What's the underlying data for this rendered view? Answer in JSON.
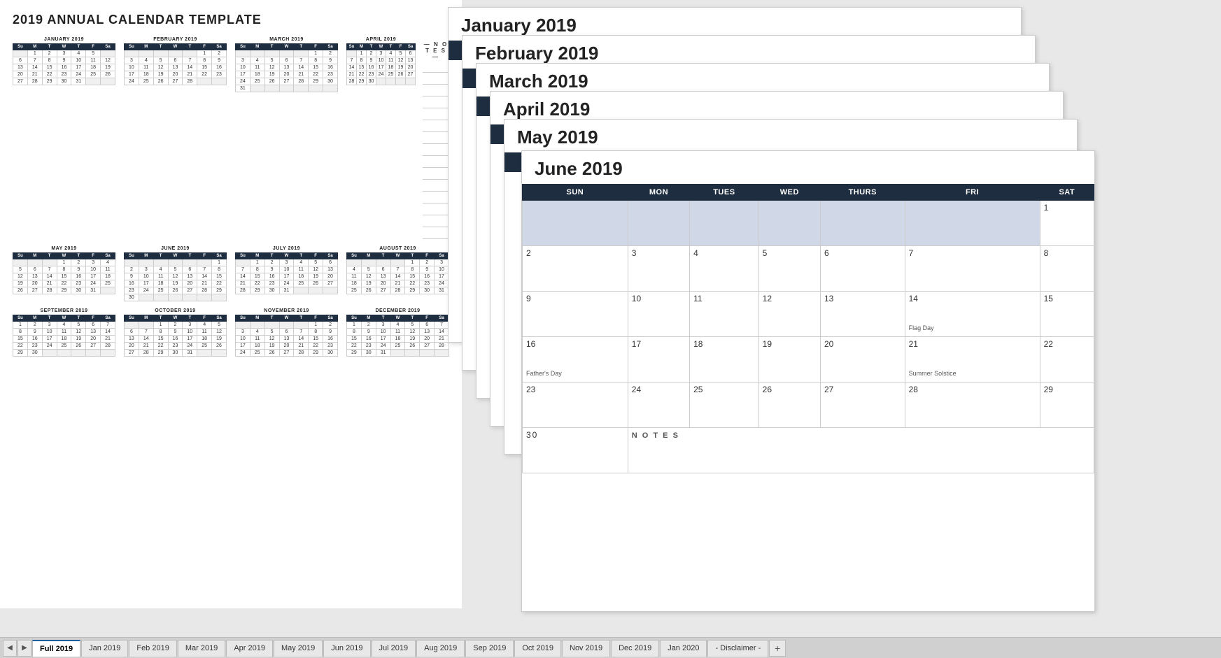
{
  "title": "2019 ANNUAL CALENDAR TEMPLATE",
  "months": {
    "jan": {
      "name": "JANUARY 2019",
      "headers": [
        "Su",
        "M",
        "T",
        "W",
        "T",
        "F",
        "Sa"
      ],
      "weeks": [
        [
          "",
          "1",
          "2",
          "3",
          "4",
          "5",
          ""
        ],
        [
          "6",
          "7",
          "8",
          "9",
          "10",
          "11",
          "12"
        ],
        [
          "13",
          "14",
          "15",
          "16",
          "17",
          "18",
          "19"
        ],
        [
          "20",
          "21",
          "22",
          "23",
          "24",
          "25",
          "26"
        ],
        [
          "27",
          "28",
          "29",
          "30",
          "31",
          "",
          ""
        ]
      ]
    },
    "feb": {
      "name": "FEBRUARY 2019",
      "headers": [
        "Su",
        "M",
        "T",
        "W",
        "T",
        "F",
        "Sa"
      ],
      "weeks": [
        [
          "",
          "",
          "",
          "",
          "",
          "1",
          "2"
        ],
        [
          "3",
          "4",
          "5",
          "6",
          "7",
          "8",
          "9"
        ],
        [
          "10",
          "11",
          "12",
          "13",
          "14",
          "15",
          "16"
        ],
        [
          "17",
          "18",
          "19",
          "20",
          "21",
          "22",
          "23"
        ],
        [
          "24",
          "25",
          "26",
          "27",
          "28",
          "",
          ""
        ]
      ]
    },
    "mar": {
      "name": "MARCH 2019",
      "headers": [
        "Su",
        "M",
        "T",
        "W",
        "T",
        "F",
        "Sa"
      ],
      "weeks": [
        [
          "",
          "",
          "",
          "",
          "",
          "1",
          "2"
        ],
        [
          "3",
          "4",
          "5",
          "6",
          "7",
          "8",
          "9"
        ],
        [
          "10",
          "11",
          "12",
          "13",
          "14",
          "15",
          "16"
        ],
        [
          "17",
          "18",
          "19",
          "20",
          "21",
          "22",
          "23"
        ],
        [
          "24",
          "25",
          "26",
          "27",
          "28",
          "29",
          "30"
        ],
        [
          "31",
          "",
          "",
          "",
          "",
          "",
          ""
        ]
      ]
    },
    "apr": {
      "name": "APRIL 2019",
      "headers": [
        "Su",
        "M",
        "T",
        "W",
        "T",
        "F",
        "Sa"
      ],
      "weeks": [
        [
          "",
          "1",
          "2",
          "3",
          "4",
          "5",
          "6"
        ],
        [
          "7",
          "8",
          "9",
          "10",
          "11",
          "12",
          "13"
        ],
        [
          "14",
          "15",
          "16",
          "17",
          "18",
          "19",
          "20"
        ],
        [
          "21",
          "22",
          "23",
          "24",
          "25",
          "26",
          "27"
        ],
        [
          "28",
          "29",
          "30",
          "",
          "",
          "",
          ""
        ]
      ]
    },
    "may": {
      "name": "MAY 2019",
      "headers": [
        "Su",
        "M",
        "T",
        "W",
        "T",
        "F",
        "Sa"
      ],
      "weeks": [
        [
          "",
          "",
          "",
          "1",
          "2",
          "3",
          "4"
        ],
        [
          "5",
          "6",
          "7",
          "8",
          "9",
          "10",
          "11"
        ],
        [
          "12",
          "13",
          "14",
          "15",
          "16",
          "17",
          "18"
        ],
        [
          "19",
          "20",
          "21",
          "22",
          "23",
          "24",
          "25"
        ],
        [
          "26",
          "27",
          "28",
          "29",
          "30",
          "31",
          ""
        ]
      ]
    },
    "jun": {
      "name": "JUNE 2019",
      "headers": [
        "Su",
        "M",
        "T",
        "W",
        "T",
        "F",
        "Sa"
      ],
      "weeks": [
        [
          "",
          "",
          "",
          "",
          "",
          "",
          "1"
        ],
        [
          "2",
          "3",
          "4",
          "5",
          "6",
          "7",
          "8"
        ],
        [
          "9",
          "10",
          "11",
          "12",
          "13",
          "14",
          "15"
        ],
        [
          "16",
          "17",
          "18",
          "19",
          "20",
          "21",
          "22"
        ],
        [
          "23",
          "24",
          "25",
          "26",
          "27",
          "28",
          "29"
        ],
        [
          "30",
          "",
          "",
          "",
          "",
          "",
          ""
        ]
      ],
      "notes": {
        "14": "Flag Day",
        "16": "Father's Day",
        "21": "Summer Solstice"
      }
    },
    "jul": {
      "name": "JULY 2019",
      "headers": [
        "Su",
        "M",
        "T",
        "W",
        "T",
        "F",
        "Sa"
      ],
      "weeks": [
        [
          "",
          "1",
          "2",
          "3",
          "4",
          "5",
          "6"
        ],
        [
          "7",
          "8",
          "9",
          "10",
          "11",
          "12",
          "13"
        ],
        [
          "14",
          "15",
          "16",
          "17",
          "18",
          "19",
          "20"
        ],
        [
          "21",
          "22",
          "23",
          "24",
          "25",
          "26",
          "27"
        ],
        [
          "28",
          "29",
          "30",
          "31",
          "",
          "",
          ""
        ]
      ]
    },
    "aug": {
      "name": "AUGUST 2019",
      "headers": [
        "Su",
        "M",
        "T",
        "W",
        "T",
        "F",
        "Sa"
      ],
      "weeks": [
        [
          "",
          "",
          "",
          "",
          "1",
          "2",
          "3"
        ],
        [
          "4",
          "5",
          "6",
          "7",
          "8",
          "9",
          "10"
        ],
        [
          "11",
          "12",
          "13",
          "14",
          "15",
          "16",
          "17"
        ],
        [
          "18",
          "19",
          "20",
          "21",
          "22",
          "23",
          "24"
        ],
        [
          "25",
          "26",
          "27",
          "28",
          "29",
          "30",
          "31"
        ]
      ]
    },
    "sep": {
      "name": "SEPTEMBER 2019",
      "headers": [
        "Su",
        "M",
        "T",
        "W",
        "T",
        "F",
        "Sa"
      ],
      "weeks": [
        [
          "1",
          "2",
          "3",
          "4",
          "5",
          "6",
          "7"
        ],
        [
          "8",
          "9",
          "10",
          "11",
          "12",
          "13",
          "14"
        ],
        [
          "15",
          "16",
          "17",
          "18",
          "19",
          "20",
          "21"
        ],
        [
          "22",
          "23",
          "24",
          "25",
          "26",
          "27",
          "28"
        ],
        [
          "29",
          "30",
          "",
          "",
          "",
          "",
          ""
        ]
      ]
    },
    "oct": {
      "name": "OCTOBER 2019",
      "headers": [
        "Su",
        "M",
        "T",
        "W",
        "T",
        "F",
        "Sa"
      ],
      "weeks": [
        [
          "",
          "",
          "1",
          "2",
          "3",
          "4",
          "5"
        ],
        [
          "6",
          "7",
          "8",
          "9",
          "10",
          "11",
          "12"
        ],
        [
          "13",
          "14",
          "15",
          "16",
          "17",
          "18",
          "19"
        ],
        [
          "20",
          "21",
          "22",
          "23",
          "24",
          "25",
          "26"
        ],
        [
          "27",
          "28",
          "29",
          "30",
          "31",
          "",
          ""
        ]
      ]
    },
    "nov": {
      "name": "NOVEMBER 2019",
      "headers": [
        "Su",
        "M",
        "T",
        "W",
        "T",
        "F",
        "Sa"
      ],
      "weeks": [
        [
          "",
          "",
          "",
          "",
          "",
          "1",
          "2"
        ],
        [
          "3",
          "4",
          "5",
          "6",
          "7",
          "8",
          "9"
        ],
        [
          "10",
          "11",
          "12",
          "13",
          "14",
          "15",
          "16"
        ],
        [
          "17",
          "18",
          "19",
          "20",
          "21",
          "22",
          "23"
        ],
        [
          "24",
          "25",
          "26",
          "27",
          "28",
          "29",
          "30"
        ]
      ]
    },
    "dec": {
      "name": "DECEMBER 2019",
      "headers": [
        "Su",
        "M",
        "T",
        "W",
        "T",
        "F",
        "Sa"
      ],
      "weeks": [
        [
          "1",
          "2",
          "3",
          "4",
          "5",
          "6",
          "7"
        ],
        [
          "8",
          "9",
          "10",
          "11",
          "12",
          "13",
          "14"
        ],
        [
          "15",
          "16",
          "17",
          "18",
          "19",
          "20",
          "21"
        ],
        [
          "22",
          "23",
          "24",
          "25",
          "26",
          "27",
          "28"
        ],
        [
          "29",
          "30",
          "31",
          "",
          "",
          "",
          ""
        ]
      ]
    }
  },
  "notes_label": "— N O T E S —",
  "tabs": [
    {
      "label": "Full 2019",
      "active": true
    },
    {
      "label": "Jan 2019",
      "active": false
    },
    {
      "label": "Feb 2019",
      "active": false
    },
    {
      "label": "Mar 2019",
      "active": false
    },
    {
      "label": "Apr 2019",
      "active": false
    },
    {
      "label": "May 2019",
      "active": false
    },
    {
      "label": "Jun 2019",
      "active": false
    },
    {
      "label": "Jul 2019",
      "active": false
    },
    {
      "label": "Aug 2019",
      "active": false
    },
    {
      "label": "Sep 2019",
      "active": false
    },
    {
      "label": "Oct 2019",
      "active": false
    },
    {
      "label": "Nov 2019",
      "active": false
    },
    {
      "label": "Dec 2019",
      "active": false
    },
    {
      "label": "Jan 2020",
      "active": false
    },
    {
      "label": "- Disclaimer -",
      "active": false
    }
  ],
  "stacked_months": [
    {
      "label": "January 2019"
    },
    {
      "label": "February 2019"
    },
    {
      "label": "March 2019"
    },
    {
      "label": "April 2019"
    },
    {
      "label": "May 2019"
    },
    {
      "label": "June 2019"
    }
  ],
  "col_headers": [
    "SUN",
    "MON",
    "TUES",
    "WED",
    "THURS",
    "FRI",
    "SAT"
  ]
}
